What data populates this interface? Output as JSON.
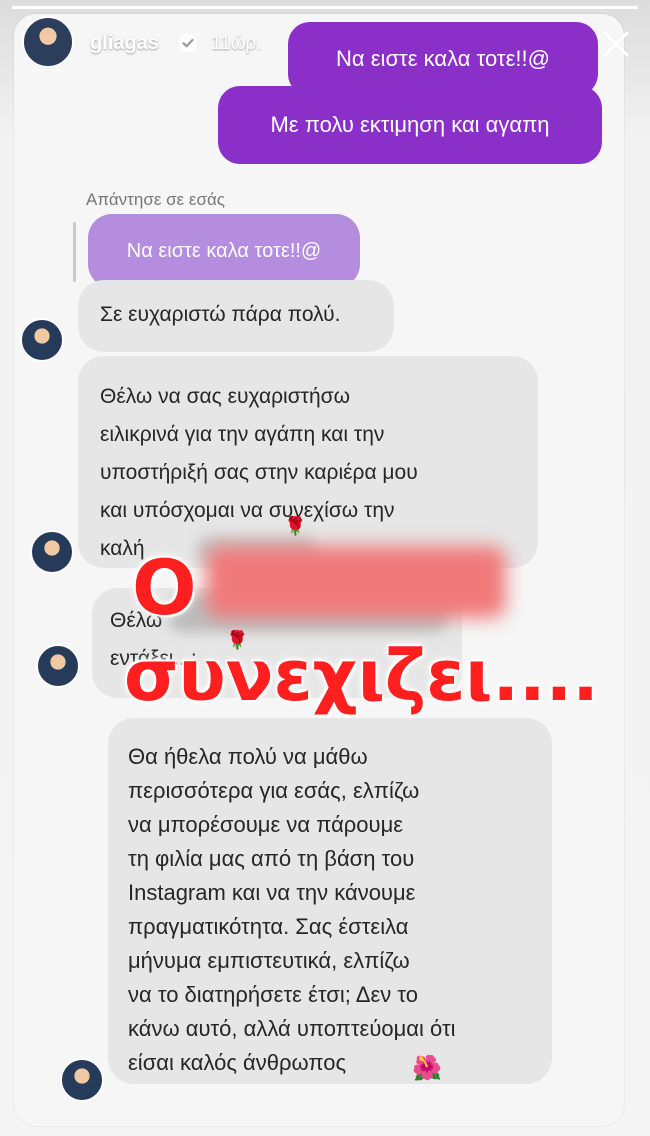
{
  "header": {
    "username": "gliagas",
    "time": "11ώρ.",
    "verified_icon": "verified-badge-icon",
    "close_icon": "close-icon"
  },
  "story": {
    "progress": 1.0
  },
  "messages": {
    "sent_1": "Να ειστε καλα τοτε!!@",
    "sent_2": "Με πολυ εκτιμηση και αγαπη",
    "reply_label": "Απάντησε σε εσάς",
    "reply_quote": "Να ειστε καλα τοτε!!@",
    "received_1": "Σε ευχαριστώ πάρα πολύ.",
    "received_2_lines": "Θέλω να σας ευχαριστήσω\nειλικρινά για την αγάπη και την\nυποστήριξή σας στην καριέρα μου\nκαι υπόσχομαι να συνεχίσω την\nκαλή",
    "received_3_start": "Θέλω",
    "received_3_line2": "εντάξει...;",
    "received_4": "Θα ήθελα πολύ να μάθω\nπερισσότερα για εσάς, ελπίζω\nνα μπορέσουμε να πάρουμε\nτη φιλία μας από τη βάση του\nInstagram και να την κάνουμε\nπραγματικότητα. Σας έστειλα\nμήνυμα εμπιστευτικά, ελπίζω\nνα το διατηρήσετε έτσι;  Δεν το\nκάνω αυτό, αλλά υποπτεύομαι ότι\nείσαι καλός άνθρωπος"
  },
  "overlay": {
    "line1_visible": "Ο",
    "line2": "συνεχιζει....",
    "color": "#ff1f1f"
  },
  "icons": {
    "rose": "🌹",
    "flower": "🌺"
  },
  "colors": {
    "sent_bubble": "#8b2fc9",
    "reply_bubble": "#b48ddf",
    "received_bubble": "#e6e6e6"
  }
}
